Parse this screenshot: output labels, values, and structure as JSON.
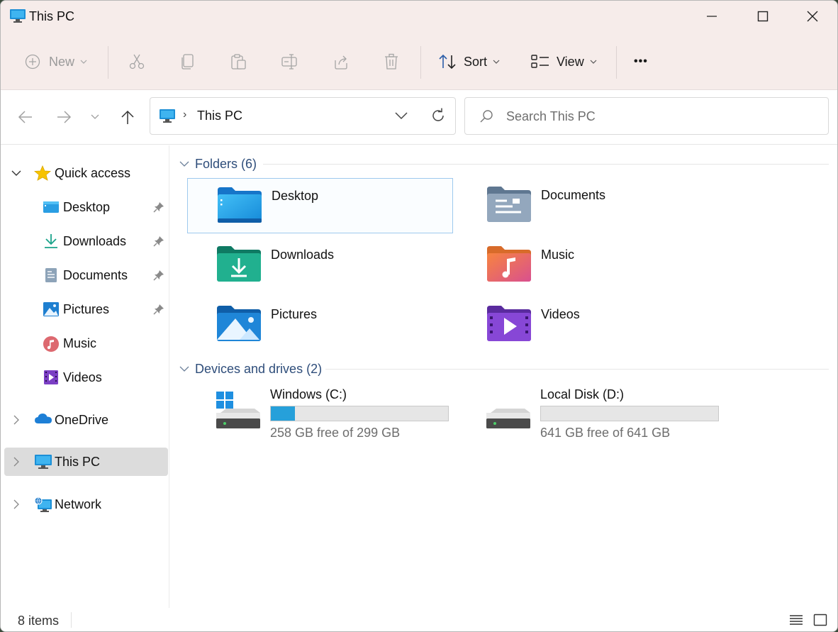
{
  "window": {
    "title": "This PC"
  },
  "toolbar": {
    "new_label": "New",
    "sort_label": "Sort",
    "view_label": "View",
    "more_label": "•••"
  },
  "address": {
    "path": "This PC",
    "search_placeholder": "Search This PC"
  },
  "sidebar": {
    "items": [
      {
        "label": "Quick access",
        "icon": "star-icon"
      },
      {
        "label": "Desktop",
        "icon": "desktop-icon",
        "pinned": true
      },
      {
        "label": "Downloads",
        "icon": "downloads-icon",
        "pinned": true
      },
      {
        "label": "Documents",
        "icon": "documents-icon",
        "pinned": true
      },
      {
        "label": "Pictures",
        "icon": "pictures-icon",
        "pinned": true
      },
      {
        "label": "Music",
        "icon": "music-icon"
      },
      {
        "label": "Videos",
        "icon": "videos-icon"
      },
      {
        "label": "OneDrive",
        "icon": "onedrive-icon"
      },
      {
        "label": "This PC",
        "icon": "this-pc-icon",
        "selected": true
      },
      {
        "label": "Network",
        "icon": "network-icon"
      }
    ]
  },
  "content": {
    "folders_header": "Folders (6)",
    "folders": [
      {
        "name": "Desktop",
        "icon": "desktop-folder-icon"
      },
      {
        "name": "Documents",
        "icon": "documents-folder-icon"
      },
      {
        "name": "Downloads",
        "icon": "downloads-folder-icon"
      },
      {
        "name": "Music",
        "icon": "music-folder-icon"
      },
      {
        "name": "Pictures",
        "icon": "pictures-folder-icon"
      },
      {
        "name": "Videos",
        "icon": "videos-folder-icon"
      }
    ],
    "drives_header": "Devices and drives (2)",
    "drives": [
      {
        "name": "Windows (C:)",
        "free_text": "258 GB free of 299 GB",
        "used_fraction": 0.137
      },
      {
        "name": "Local Disk (D:)",
        "free_text": "641 GB free of 641 GB",
        "used_fraction": 0.0
      }
    ]
  },
  "status": {
    "items_text": "8 items"
  },
  "colors": {
    "accent": "#26a0da",
    "section_header": "#2e4d7a",
    "chrome_bg": "#f6ecea",
    "selected_bg": "#dcdcdc"
  }
}
